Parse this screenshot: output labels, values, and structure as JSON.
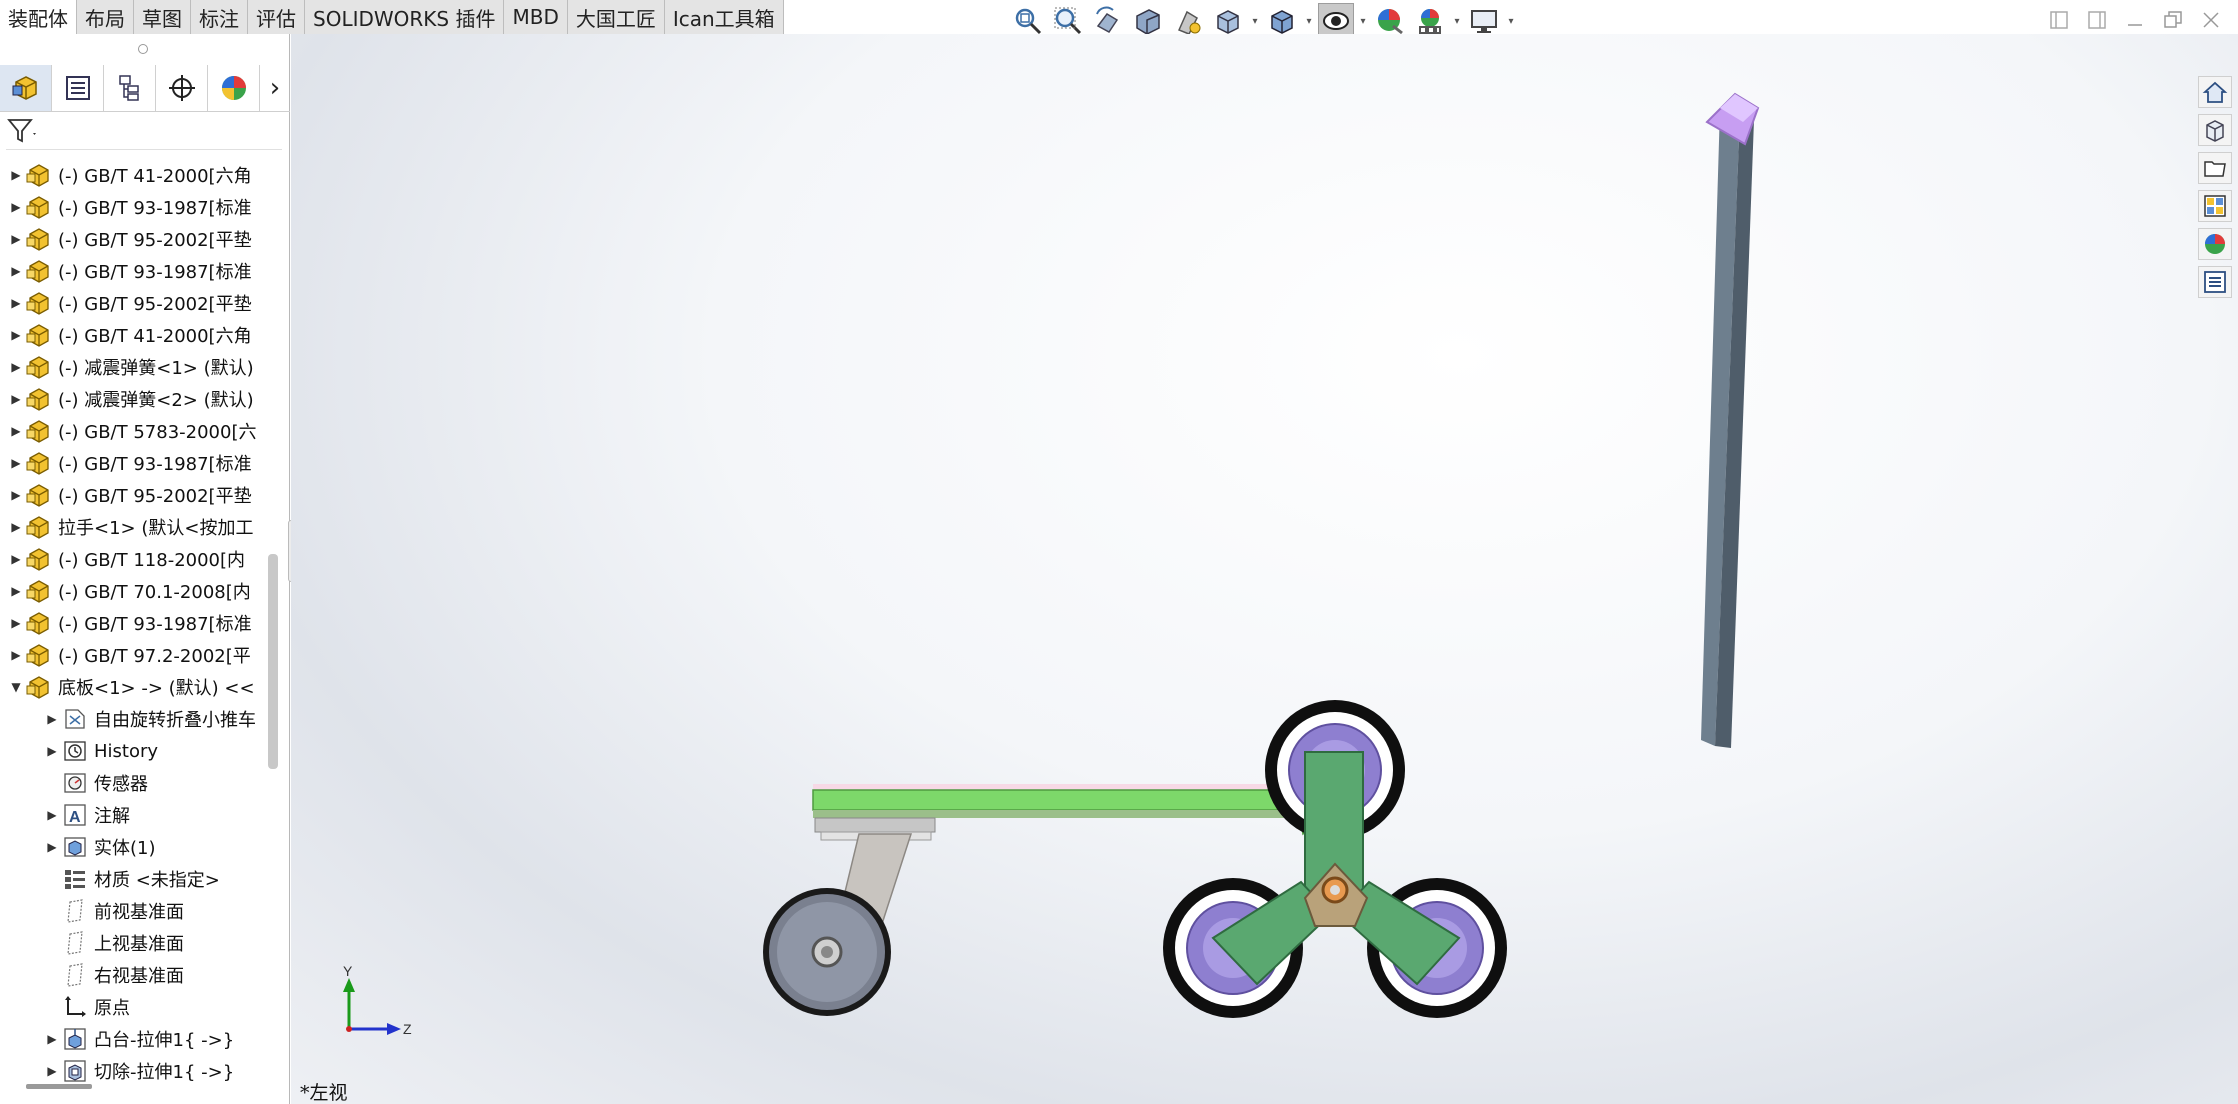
{
  "command_tabs": [
    "装配体",
    "布局",
    "草图",
    "标注",
    "评估",
    "SOLIDWORKS 插件",
    "MBD",
    "大国工匠",
    "Ican工具箱"
  ],
  "active_tab_index": 0,
  "hud_icons": [
    "zoom-to-fit-icon",
    "zoom-area-icon",
    "previous-view-icon",
    "section-view-icon",
    "dynamic-annotation-icon",
    "view-orientation-icon",
    "display-style-icon",
    "hide-show-items-icon",
    "edit-appearance-icon",
    "apply-scene-icon",
    "view-settings-icon"
  ],
  "panel_tabs": [
    "featuremanager-tab-icon",
    "propertymanager-tab-icon",
    "configurationmanager-tab-icon",
    "dimxpert-tab-icon",
    "displaymanager-tab-icon"
  ],
  "tree": [
    {
      "label": "(-) GB/T 41-2000[六角",
      "level": 0,
      "expand": "collapsed",
      "icon": "part-icon"
    },
    {
      "label": "(-) GB/T 93-1987[标准",
      "level": 0,
      "expand": "collapsed",
      "icon": "part-icon"
    },
    {
      "label": "(-) GB/T 95-2002[平垫",
      "level": 0,
      "expand": "collapsed",
      "icon": "part-icon"
    },
    {
      "label": "(-) GB/T 93-1987[标准",
      "level": 0,
      "expand": "collapsed",
      "icon": "part-icon"
    },
    {
      "label": "(-) GB/T 95-2002[平垫",
      "level": 0,
      "expand": "collapsed",
      "icon": "part-icon"
    },
    {
      "label": "(-) GB/T 41-2000[六角",
      "level": 0,
      "expand": "collapsed",
      "icon": "part-icon"
    },
    {
      "label": "(-) 减震弹簧<1> (默认)",
      "level": 0,
      "expand": "collapsed",
      "icon": "part-icon"
    },
    {
      "label": "(-) 减震弹簧<2> (默认)",
      "level": 0,
      "expand": "collapsed",
      "icon": "part-icon"
    },
    {
      "label": "(-) GB/T 5783-2000[六",
      "level": 0,
      "expand": "collapsed",
      "icon": "part-icon"
    },
    {
      "label": "(-) GB/T 93-1987[标准",
      "level": 0,
      "expand": "collapsed",
      "icon": "part-icon"
    },
    {
      "label": "(-) GB/T 95-2002[平垫",
      "level": 0,
      "expand": "collapsed",
      "icon": "part-icon"
    },
    {
      "label": "拉手<1> (默认<按加工",
      "level": 0,
      "expand": "collapsed",
      "icon": "part-icon"
    },
    {
      "label": "(-) GB/T 118-2000[内",
      "level": 0,
      "expand": "collapsed",
      "icon": "part-icon"
    },
    {
      "label": "(-) GB/T 70.1-2008[内",
      "level": 0,
      "expand": "collapsed",
      "icon": "part-icon"
    },
    {
      "label": "(-) GB/T 93-1987[标准",
      "level": 0,
      "expand": "collapsed",
      "icon": "part-icon"
    },
    {
      "label": "(-) GB/T 97.2-2002[平",
      "level": 0,
      "expand": "collapsed",
      "icon": "part-icon"
    },
    {
      "label": "底板<1> -> (默认) <<",
      "level": 0,
      "expand": "expanded",
      "icon": "part-icon"
    },
    {
      "label": "自由旋转折叠小推车",
      "level": 1,
      "expand": "collapsed",
      "icon": "folder-icon"
    },
    {
      "label": "History",
      "level": 1,
      "expand": "collapsed",
      "icon": "history-icon"
    },
    {
      "label": "传感器",
      "level": 1,
      "expand": "none",
      "icon": "sensor-icon"
    },
    {
      "label": "注解",
      "level": 1,
      "expand": "collapsed",
      "icon": "annotation-icon"
    },
    {
      "label": "实体(1)",
      "level": 1,
      "expand": "collapsed",
      "icon": "solid-body-icon"
    },
    {
      "label": "材质 <未指定>",
      "level": 1,
      "expand": "none",
      "icon": "material-icon"
    },
    {
      "label": "前视基准面",
      "level": 1,
      "expand": "none",
      "icon": "plane-icon"
    },
    {
      "label": "上视基准面",
      "level": 1,
      "expand": "none",
      "icon": "plane-icon"
    },
    {
      "label": "右视基准面",
      "level": 1,
      "expand": "none",
      "icon": "plane-icon"
    },
    {
      "label": "原点",
      "level": 1,
      "expand": "none",
      "icon": "origin-icon"
    },
    {
      "label": "凸台-拉伸1{ ->}",
      "level": 1,
      "expand": "collapsed",
      "icon": "boss-extrude-icon"
    },
    {
      "label": "切除-拉伸1{ ->}",
      "level": 1,
      "expand": "collapsed",
      "icon": "cut-extrude-icon"
    }
  ],
  "viewport": {
    "view_label": "*左视",
    "triad": {
      "y_label": "Y",
      "z_label": "Z"
    }
  },
  "task_pane": [
    "solidworks-resources-icon",
    "design-library-icon",
    "file-explorer-icon",
    "view-palette-icon",
    "appearances-icon",
    "custom-properties-icon"
  ],
  "colors": {
    "frame": "#7dd86a",
    "body": "#5aa870",
    "handle": "#6e7f8e",
    "grip": "#c79ef2",
    "star_hub": "#8e7fd0",
    "tire": "#111111"
  }
}
